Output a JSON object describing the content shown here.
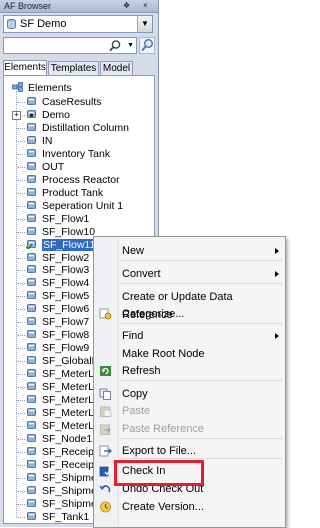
{
  "titlebar": {
    "title": "AF Browser",
    "pin_glyph": "✕",
    "close_glyph": "×"
  },
  "database_combo": {
    "selected": "SF Demo"
  },
  "search": {
    "value": "",
    "placeholder": ""
  },
  "tabs": [
    {
      "label": "Elements",
      "active": true
    },
    {
      "label": "Templates",
      "active": false
    },
    {
      "label": "Model",
      "active": false
    }
  ],
  "tree": {
    "root": "Elements",
    "items": [
      {
        "label": "CaseResults"
      },
      {
        "label": "Demo"
      },
      {
        "label": "Distillation Column"
      },
      {
        "label": "IN"
      },
      {
        "label": "Inventory Tank"
      },
      {
        "label": "OUT"
      },
      {
        "label": "Process Reactor"
      },
      {
        "label": "Product Tank"
      },
      {
        "label": "Seperation Unit 1"
      },
      {
        "label": "SF_Flow1"
      },
      {
        "label": "SF_Flow10"
      },
      {
        "label": "SF_Flow11"
      },
      {
        "label": "SF_Flow2"
      },
      {
        "label": "SF_Flow3"
      },
      {
        "label": "SF_Flow4"
      },
      {
        "label": "SF_Flow5"
      },
      {
        "label": "SF_Flow6"
      },
      {
        "label": "SF_Flow7"
      },
      {
        "label": "SF_Flow8"
      },
      {
        "label": "SF_Flow9"
      },
      {
        "label": "SF_GlobalF"
      },
      {
        "label": "SF_MeterLi"
      },
      {
        "label": "SF_MeterLi"
      },
      {
        "label": "SF_MeterLi"
      },
      {
        "label": "SF_MeterLi"
      },
      {
        "label": "SF_MeterLi"
      },
      {
        "label": "SF_Node1"
      },
      {
        "label": "SF_Receip"
      },
      {
        "label": "SF_Receip"
      },
      {
        "label": "SF_Shipme"
      },
      {
        "label": "SF_Shipme"
      },
      {
        "label": "SF_Shipme"
      },
      {
        "label": "SF_Tank1"
      }
    ]
  },
  "context_menu": {
    "items": [
      {
        "label": "New",
        "submenu": true,
        "disabled": false,
        "icon": "none"
      },
      {
        "label": "Convert",
        "submenu": true,
        "disabled": false,
        "icon": "none"
      },
      {
        "label": "Create or Update Data Reference",
        "submenu": false,
        "disabled": false,
        "icon": "none"
      },
      {
        "label": "Categorize...",
        "submenu": false,
        "disabled": false,
        "icon": "categorize-icon"
      },
      {
        "label": "Find",
        "submenu": true,
        "disabled": false,
        "icon": "none"
      },
      {
        "label": "Make Root Node",
        "submenu": false,
        "disabled": false,
        "icon": "none"
      },
      {
        "label": "Refresh",
        "submenu": false,
        "disabled": false,
        "icon": "refresh-icon"
      },
      {
        "label": "Copy",
        "submenu": false,
        "disabled": false,
        "icon": "copy-icon"
      },
      {
        "label": "Paste",
        "submenu": false,
        "disabled": true,
        "icon": "paste-icon"
      },
      {
        "label": "Paste Reference",
        "submenu": false,
        "disabled": true,
        "icon": "paste-reference-icon"
      },
      {
        "label": "Export to File...",
        "submenu": false,
        "disabled": false,
        "icon": "export-icon"
      },
      {
        "label": "Check In",
        "submenu": false,
        "disabled": false,
        "icon": "check-in-icon"
      },
      {
        "label": "Undo Check Out",
        "submenu": false,
        "disabled": false,
        "icon": "undo-check-out-icon"
      },
      {
        "label": "Create Version...",
        "submenu": false,
        "disabled": false,
        "icon": "create-version-icon"
      }
    ]
  },
  "colors": {
    "selection": "#316ac5",
    "highlight_box": "#e0202f",
    "panel_bg": "#d6dbe9"
  }
}
